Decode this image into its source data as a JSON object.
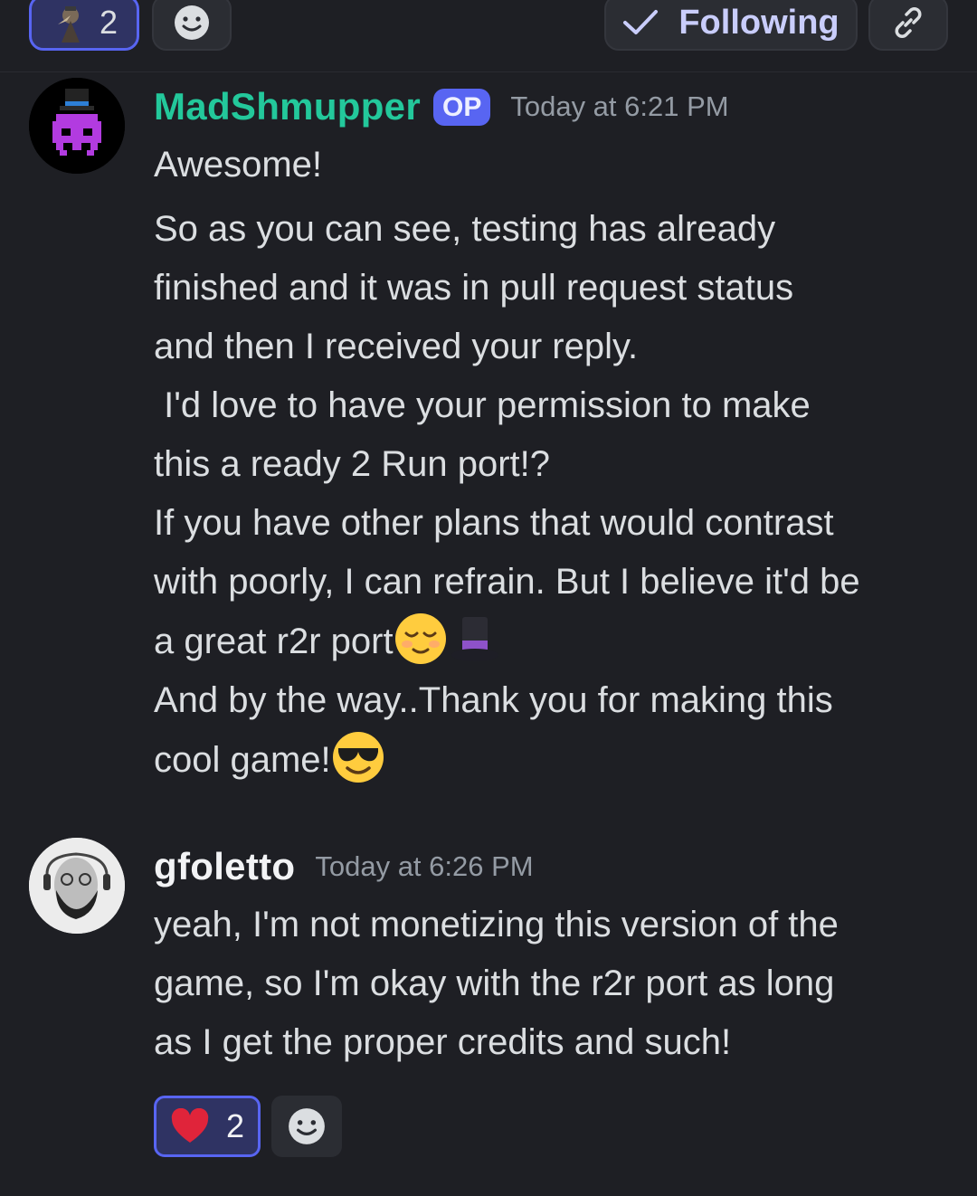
{
  "topbar": {
    "reaction": {
      "emoji": "plague-doctor-emoji",
      "count": "2"
    },
    "add_reaction_icon": "smiley-add-icon",
    "following_label": "Following",
    "link_icon": "link-icon"
  },
  "messages": [
    {
      "username": "MadShmupper",
      "username_color": "#23c89b",
      "badge": "OP",
      "timestamp": "Today at 6:21 PM",
      "lines": [
        "Awesome!",
        "So as you can see, testing has already",
        "finished and it was in pull request status",
        "and then I received your reply.",
        " I'd love to have your permission to make",
        "this a ready 2 Run port!?",
        "If you have other plans that would contrast",
        "with poorly, I can refrain. But I believe it'd be",
        "a great r2r port",
        "And by the way..Thank you for making this",
        "cool game!"
      ],
      "inline_emojis": [
        "relieved-face-emoji",
        "top-hat-emoji",
        "smiling-face-with-sunglasses-emoji"
      ]
    },
    {
      "username": "gfoletto",
      "username_color": "#f2f3f5",
      "timestamp": "Today at 6:26 PM",
      "lines": [
        "yeah, I'm not monetizing this version of the",
        "game, so I'm okay with the r2r port as long",
        "as I get the proper credits and such!"
      ],
      "reaction": {
        "emoji": "red-heart-emoji",
        "count": "2"
      },
      "add_reaction_icon": "smiley-add-icon"
    }
  ],
  "colors": {
    "background": "#1e1f24",
    "accent": "#5865f2",
    "text": "#dbdee1",
    "muted": "#949ba4"
  }
}
